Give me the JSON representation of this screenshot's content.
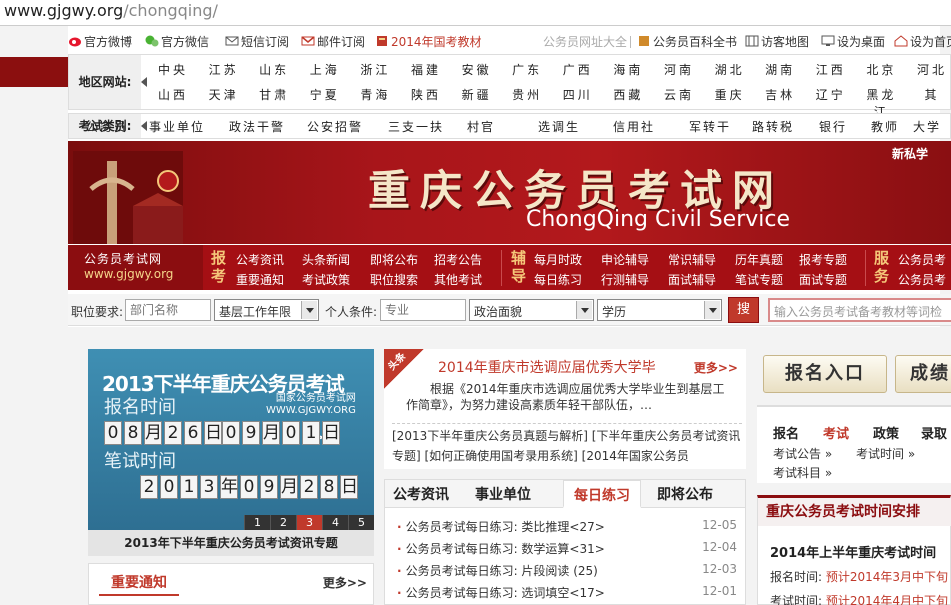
{
  "url": {
    "domain": "www.gjgwy.org",
    "path": "/chongqing/"
  },
  "topnav": {
    "weibo": "官方微博",
    "weixin": "官方微信",
    "sms": "短信订阅",
    "mail": "邮件订阅",
    "textbook": "2014年国考教材",
    "portal": "公务员网址大全",
    "encyclopedia": "公务员百科全书",
    "sitemap": "访客地图",
    "desktop": "设为桌面",
    "homepage": "设为首页"
  },
  "region": {
    "label": "地区网站:",
    "row1": [
      "中央",
      "江苏",
      "山东",
      "上海",
      "浙江",
      "福建",
      "安徽",
      "广东",
      "广西",
      "海南",
      "河南",
      "湖北",
      "湖南",
      "江西",
      "北京",
      "河北"
    ],
    "row2": [
      "山西",
      "天津",
      "甘肃",
      "宁夏",
      "青海",
      "陕西",
      "新疆",
      "贵州",
      "四川",
      "西藏",
      "云南",
      "重庆",
      "吉林",
      "辽宁",
      "黑龙江",
      "其"
    ]
  },
  "exam": {
    "label": "考试类别:",
    "items": [
      "公务员",
      "事业单位",
      "政法干警",
      "公安招警",
      "三支一扶",
      "村官",
      "选调生",
      "信用社",
      "军转干",
      "路转税",
      "银行",
      "教师",
      "大学"
    ]
  },
  "banner": {
    "title": "重庆公务员考试网",
    "en": "ChongQing Civil Service",
    "brand": "新私学"
  },
  "subnav": {
    "logo_cn": "公务员考试网",
    "logo_url": "www.gjgwy.org",
    "g1": "报考",
    "g1_links": [
      [
        "公考资讯",
        "头条新闻",
        "即将公布",
        "招考公告"
      ],
      [
        "重要通知",
        "考试政策",
        "职位搜索",
        "其他考试"
      ]
    ],
    "g2": "辅导",
    "g2_links": [
      [
        "每月时政",
        "申论辅导",
        "常识辅导",
        "历年真题",
        "报考专题"
      ],
      [
        "每日练习",
        "行测辅导",
        "面试辅导",
        "笔试专题",
        "面试专题"
      ]
    ],
    "g3": "服务",
    "g3_links": [
      "公务员考",
      "公务员考"
    ]
  },
  "search": {
    "job_label": "职位要求:",
    "dept_placeholder": "部门名称",
    "years": "基层工作年限",
    "personal_label": "个人条件:",
    "major_placeholder": "专业",
    "politics": "政治面貌",
    "edu": "学历",
    "go": "搜",
    "kw_placeholder": "输入公务员考试备考教材等词检"
  },
  "slide": {
    "heading": "2013下半年重庆公务员考试",
    "site_name": "国家公务员考试网",
    "site_url": "WWW.GJGWY.ORG",
    "reg_label": "报名时间",
    "reg_start": [
      "0",
      "8",
      "月",
      "2",
      "6",
      "日"
    ],
    "reg_end": [
      "0",
      "9",
      "月",
      "0",
      "1",
      "日"
    ],
    "exam_label": "笔试时间",
    "exam_date": [
      "2",
      "0",
      "1",
      "3",
      "年",
      "0",
      "9",
      "月",
      "2",
      "8",
      "日"
    ],
    "pages": [
      "1",
      "2",
      "3",
      "4",
      "5"
    ],
    "caption": "2013年下半年重庆公务员考试资讯专题"
  },
  "notice": {
    "title": "重要通知",
    "more": "更多>>"
  },
  "news": {
    "tag": "头条",
    "headline": "2014年重庆市选调应届优秀大学毕",
    "more": "更多>>",
    "desc": "根据《2014年重庆市选调应届优秀大学毕业生到基层工作简章》，为努力建设高素质年轻干部队伍，…",
    "links": "[2013下半年重庆公务员真题与解析]  [下半年重庆公务员考试资讯专题]  [如何正确使用国考录用系统]  [2014年国家公务员"
  },
  "tabs": {
    "items": [
      "公考资讯",
      "事业单位",
      "每日练习",
      "即将公布"
    ],
    "list": [
      {
        "t": "公务员考试每日练习: 类比推理<27>",
        "d": "12-05"
      },
      {
        "t": "公务员考试每日练习: 数学运算<31>",
        "d": "12-04"
      },
      {
        "t": "公务员考试每日练习: 片段阅读 (25)",
        "d": "12-03"
      },
      {
        "t": "公务员考试每日练习: 选词填空<17>",
        "d": "12-01"
      }
    ]
  },
  "rside": {
    "btn1": "报名入口",
    "btn2": "成绩",
    "tabs": [
      "报名",
      "考试",
      "政策",
      "录取"
    ],
    "links": [
      "考试公告 »",
      "考试时间 »",
      "考试科目 »"
    ],
    "sched_title": "重庆公务员考试时间安排",
    "sched_sub": "2014年上半年重庆考试时间",
    "reg_label": "报名时间: ",
    "reg_val": "预计2014年3月中下旬",
    "exam_label": "考试时间: ",
    "exam_val": "预计2014年4月中下旬"
  }
}
